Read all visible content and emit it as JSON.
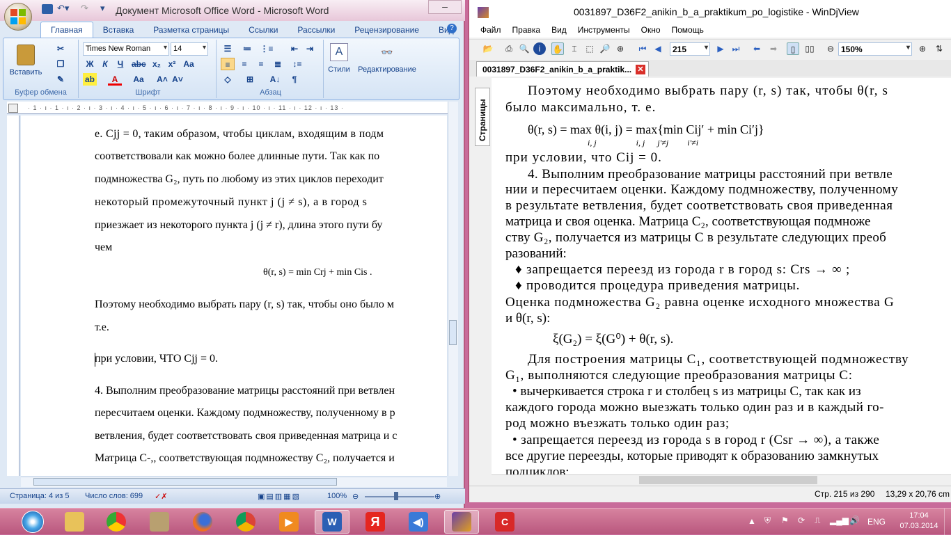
{
  "word": {
    "title": "Документ Microsoft Office Word - Microsoft Word",
    "tabs": [
      "Главная",
      "Вставка",
      "Разметка страницы",
      "Ссылки",
      "Рассылки",
      "Рецензирование",
      "Вид"
    ],
    "groups": {
      "clipboard": "Буфер обмена",
      "paste": "Вставить",
      "font": "Шрифт",
      "paragraph": "Абзац",
      "styles": "Стили",
      "editing": "Редактирование"
    },
    "font_name": "Times New Roman",
    "font_size": "14",
    "ruler": "· 1 · ı · 1 · ı · 2 · ı · 3 · ı · 4 · ı · 5 · ı · 6 · ı · 7 · ı · 8 · ı · 9 · ı · 10 · ı · 11 · ı · 12 · ı · 13 ·",
    "doc_lines": [
      "е. Cjj = 0, таким образом, чтобы циклам, входящим в подм",
      "соответствовали как можно более длинные пути. Так как по",
      "подмножества G₂, путь по любому из этих циклов переходит",
      "некоторый промежуточный пункт j (j ≠ s), а в город s",
      "приезжает из некоторого пункта j (j ≠ r), длина этого пути бу",
      "чем",
      "θ(r, s) = min Crj + min Cis .",
      "Поэтому необходимо выбрать пару (r, s) так, чтобы оно было м",
      "т.е.",
      "при условии, ЧТО Cjj = 0.",
      "4. Выполним преобразование матрицы расстояний при ветвлен",
      "пересчитаем оценки. Каждому подмножеству, полученному в р",
      "ветвления, будет соответствовать своя приведенная матрица и с",
      "Матрица С-,, соответствующая подмножеству С₂, получается и"
    ],
    "status": {
      "page": "Страница: 4 из 5",
      "words": "Число слов: 699",
      "zoom": "100%"
    }
  },
  "djview": {
    "title": "0031897_D36F2_anikin_b_a_praktikum_po_logistike - WinDjView",
    "menu": [
      "Файл",
      "Правка",
      "Вид",
      "Инструменты",
      "Окно",
      "Помощь"
    ],
    "page_number": "215",
    "zoom": "150%",
    "tab": "0031897_D36F2_anikin_b_a_praktik...",
    "side_tab": "Страницы",
    "page_lines": [
      "Поэтому необходимо выбрать пару (r, s) так, чтобы θ(r, s",
      "было максимально, т. е.",
      "θ(r, s) = max θ(i, j) = max{min Cij′ + min Ci′j}",
      "i, j                   i, j      j′≠j         i′≠i",
      "при условии, что Cij = 0.",
      "4. Выполним преобразование матрицы расстояний при ветвле",
      "нии и пересчитаем оценки. Каждому подмножеству, полученному",
      "в результате ветвления, будет соответствовать своя приведенная",
      "матрица и своя оценка. Матрица C₂, соответствующая подмноже",
      "ству G₂, получается из матрицы C в результате следующих преоб",
      "разований:",
      "♦ запрещается переезд из города r в город s: Crs → ∞ ;",
      "♦ проводится процедура приведения матрицы.",
      "Оценка подмножества G₂ равна оценке исходного множества G",
      "и θ(r, s):",
      "ξ(G₂) = ξ(G⁰) + θ(r, s).",
      "Для построения матрицы C₁, соответствующей подмножеству",
      "G₁, выполняются следующие преобразования матрицы C:",
      "• вычеркивается строка r и столбец s из матрицы C, так как из",
      "каждого города можно выезжать только один раз и в каждый го-",
      "род можно въезжать только один раз;",
      "• запрещается переезд из города s в город r (Csr → ∞), а также",
      "все другие переезды, которые приводят к образованию замкнутых",
      "подциклов;"
    ],
    "status": {
      "page": "Стр. 215 из 290",
      "size": "13,29 x 20,76 cm"
    }
  },
  "taskbar": {
    "lang": "ENG",
    "time": "17:04",
    "date": "07.03.2014"
  }
}
